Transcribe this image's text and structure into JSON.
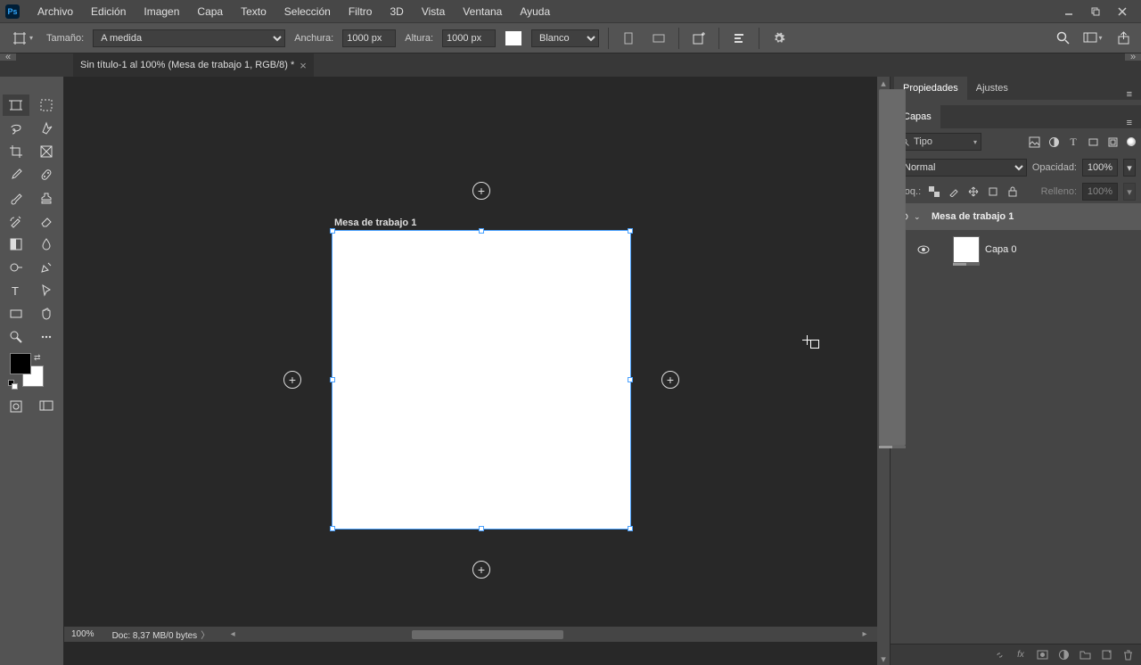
{
  "ps_abbrev": "Ps",
  "menu": [
    "Archivo",
    "Edición",
    "Imagen",
    "Capa",
    "Texto",
    "Selección",
    "Filtro",
    "3D",
    "Vista",
    "Ventana",
    "Ayuda"
  ],
  "options": {
    "size_label": "Tamaño:",
    "size_value": "A medida",
    "width_label": "Anchura:",
    "width_value": "1000 px",
    "height_label": "Altura:",
    "height_value": "1000 px",
    "bg_label": "Blanco"
  },
  "doc_tab": {
    "title": "Sin título-1 al 100% (Mesa de trabajo 1, RGB/8) *"
  },
  "canvas": {
    "artboard_label": "Mesa de trabajo 1"
  },
  "panels": {
    "properties_tab": "Propiedades",
    "adjustments_tab": "Ajustes",
    "layers_tab": "Capas",
    "filter_kind": "Tipo",
    "blend_mode": "Normal",
    "opacity_label": "Opacidad:",
    "opacity_value": "100%",
    "lock_label": "Bloq.:",
    "fill_label": "Relleno:",
    "fill_value": "100%",
    "artboard_layer": "Mesa de trabajo 1",
    "layer0": "Capa 0"
  },
  "status": {
    "zoom": "100%",
    "doc_info": "Doc: 8,37 MB/0 bytes"
  }
}
